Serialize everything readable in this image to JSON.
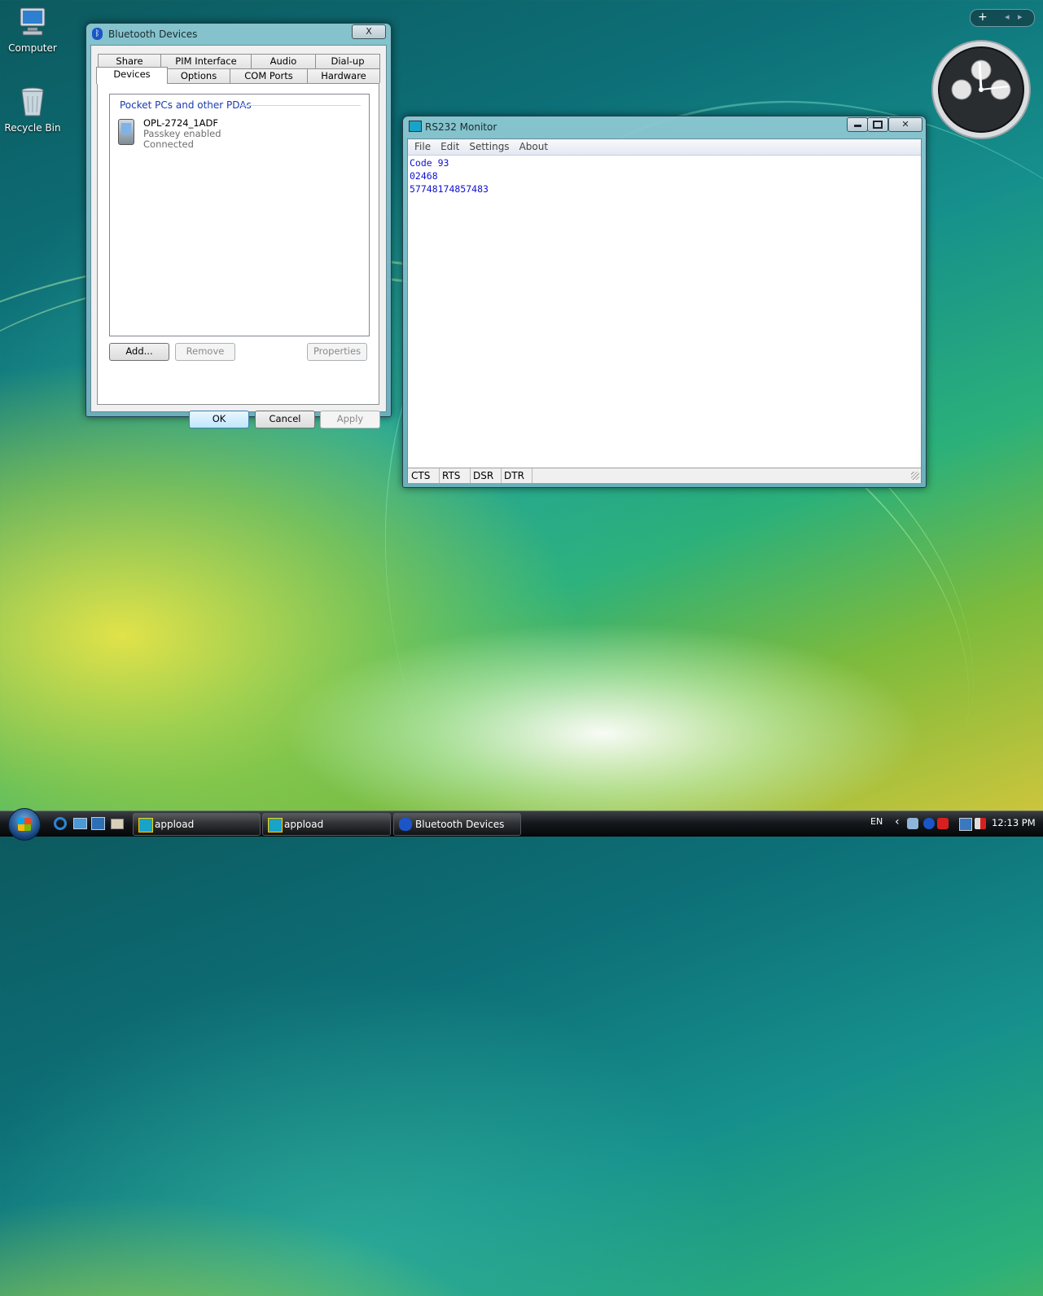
{
  "desktop": {
    "icons": [
      {
        "label": "Computer"
      },
      {
        "label": "Recycle Bin"
      }
    ]
  },
  "sidebar_gadgets": {
    "add_label": "+",
    "prev_label": "◂",
    "next_label": "▸"
  },
  "bluetooth_window": {
    "title": "Bluetooth Devices",
    "close_label": "X",
    "tabs_row1": [
      "Share",
      "PIM Interface",
      "Audio",
      "Dial-up"
    ],
    "tabs_row2": [
      "Devices",
      "Options",
      "COM Ports",
      "Hardware"
    ],
    "active_tab": "Devices",
    "group_title": "Pocket PCs and other PDAs",
    "device": {
      "name": "OPL-2724_1ADF",
      "passkey": "Passkey enabled",
      "status": "Connected"
    },
    "buttons": {
      "add": "Add...",
      "remove": "Remove",
      "properties": "Properties",
      "ok": "OK",
      "cancel": "Cancel",
      "apply": "Apply"
    }
  },
  "rs232_window": {
    "title": "RS232 Monitor",
    "menu": [
      "File",
      "Edit",
      "Settings",
      "About"
    ],
    "lines": [
      "Code 93",
      "02468",
      "57748174857483"
    ],
    "status": [
      "CTS",
      "RTS",
      "DSR",
      "DTR"
    ]
  },
  "taskbar": {
    "tasks": [
      {
        "label": "appload"
      },
      {
        "label": "appload"
      },
      {
        "label": "Bluetooth Devices"
      }
    ],
    "language": "EN",
    "time": "12:13 PM"
  },
  "colors": {
    "terminal_text": "#1010d0",
    "group_title": "#1a3bb0",
    "window_frame": "#8cc8d2"
  }
}
